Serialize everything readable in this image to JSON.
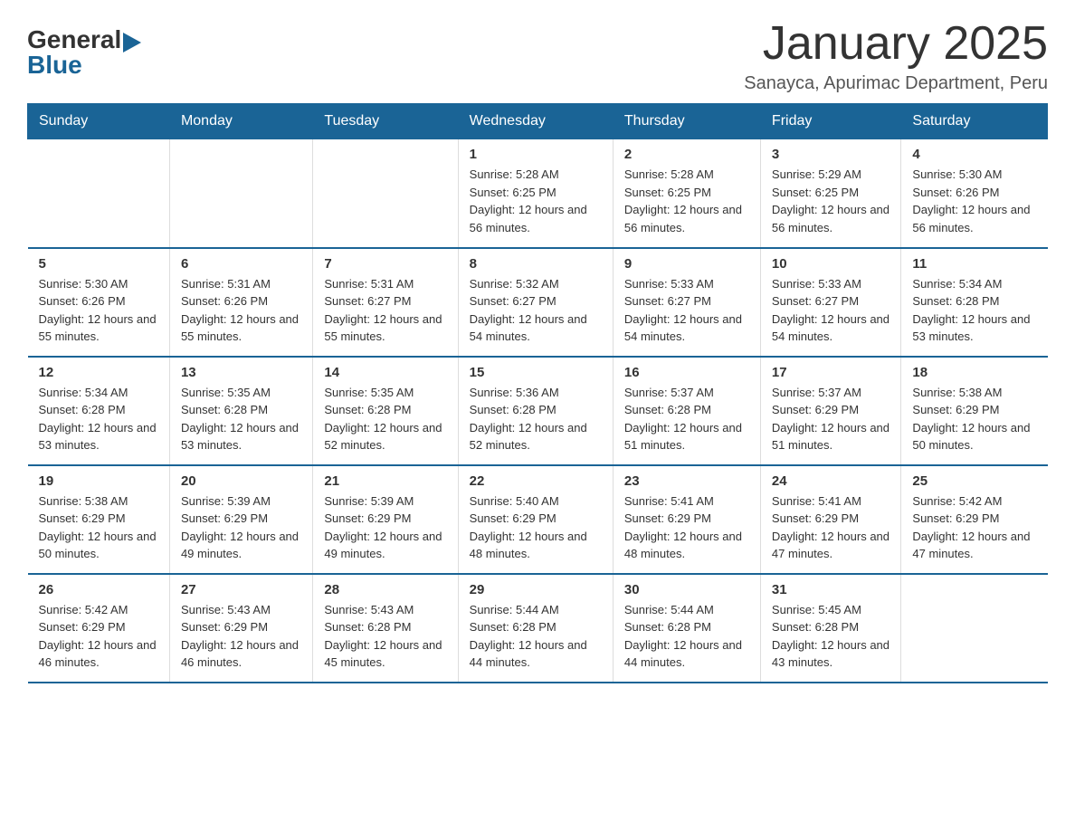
{
  "logo": {
    "general": "General",
    "arrow": "▶",
    "blue": "Blue"
  },
  "title": "January 2025",
  "subtitle": "Sanayca, Apurimac Department, Peru",
  "headers": [
    "Sunday",
    "Monday",
    "Tuesday",
    "Wednesday",
    "Thursday",
    "Friday",
    "Saturday"
  ],
  "weeks": [
    [
      {
        "day": "",
        "info": ""
      },
      {
        "day": "",
        "info": ""
      },
      {
        "day": "",
        "info": ""
      },
      {
        "day": "1",
        "info": "Sunrise: 5:28 AM\nSunset: 6:25 PM\nDaylight: 12 hours and 56 minutes."
      },
      {
        "day": "2",
        "info": "Sunrise: 5:28 AM\nSunset: 6:25 PM\nDaylight: 12 hours and 56 minutes."
      },
      {
        "day": "3",
        "info": "Sunrise: 5:29 AM\nSunset: 6:25 PM\nDaylight: 12 hours and 56 minutes."
      },
      {
        "day": "4",
        "info": "Sunrise: 5:30 AM\nSunset: 6:26 PM\nDaylight: 12 hours and 56 minutes."
      }
    ],
    [
      {
        "day": "5",
        "info": "Sunrise: 5:30 AM\nSunset: 6:26 PM\nDaylight: 12 hours and 55 minutes."
      },
      {
        "day": "6",
        "info": "Sunrise: 5:31 AM\nSunset: 6:26 PM\nDaylight: 12 hours and 55 minutes."
      },
      {
        "day": "7",
        "info": "Sunrise: 5:31 AM\nSunset: 6:27 PM\nDaylight: 12 hours and 55 minutes."
      },
      {
        "day": "8",
        "info": "Sunrise: 5:32 AM\nSunset: 6:27 PM\nDaylight: 12 hours and 54 minutes."
      },
      {
        "day": "9",
        "info": "Sunrise: 5:33 AM\nSunset: 6:27 PM\nDaylight: 12 hours and 54 minutes."
      },
      {
        "day": "10",
        "info": "Sunrise: 5:33 AM\nSunset: 6:27 PM\nDaylight: 12 hours and 54 minutes."
      },
      {
        "day": "11",
        "info": "Sunrise: 5:34 AM\nSunset: 6:28 PM\nDaylight: 12 hours and 53 minutes."
      }
    ],
    [
      {
        "day": "12",
        "info": "Sunrise: 5:34 AM\nSunset: 6:28 PM\nDaylight: 12 hours and 53 minutes."
      },
      {
        "day": "13",
        "info": "Sunrise: 5:35 AM\nSunset: 6:28 PM\nDaylight: 12 hours and 53 minutes."
      },
      {
        "day": "14",
        "info": "Sunrise: 5:35 AM\nSunset: 6:28 PM\nDaylight: 12 hours and 52 minutes."
      },
      {
        "day": "15",
        "info": "Sunrise: 5:36 AM\nSunset: 6:28 PM\nDaylight: 12 hours and 52 minutes."
      },
      {
        "day": "16",
        "info": "Sunrise: 5:37 AM\nSunset: 6:28 PM\nDaylight: 12 hours and 51 minutes."
      },
      {
        "day": "17",
        "info": "Sunrise: 5:37 AM\nSunset: 6:29 PM\nDaylight: 12 hours and 51 minutes."
      },
      {
        "day": "18",
        "info": "Sunrise: 5:38 AM\nSunset: 6:29 PM\nDaylight: 12 hours and 50 minutes."
      }
    ],
    [
      {
        "day": "19",
        "info": "Sunrise: 5:38 AM\nSunset: 6:29 PM\nDaylight: 12 hours and 50 minutes."
      },
      {
        "day": "20",
        "info": "Sunrise: 5:39 AM\nSunset: 6:29 PM\nDaylight: 12 hours and 49 minutes."
      },
      {
        "day": "21",
        "info": "Sunrise: 5:39 AM\nSunset: 6:29 PM\nDaylight: 12 hours and 49 minutes."
      },
      {
        "day": "22",
        "info": "Sunrise: 5:40 AM\nSunset: 6:29 PM\nDaylight: 12 hours and 48 minutes."
      },
      {
        "day": "23",
        "info": "Sunrise: 5:41 AM\nSunset: 6:29 PM\nDaylight: 12 hours and 48 minutes."
      },
      {
        "day": "24",
        "info": "Sunrise: 5:41 AM\nSunset: 6:29 PM\nDaylight: 12 hours and 47 minutes."
      },
      {
        "day": "25",
        "info": "Sunrise: 5:42 AM\nSunset: 6:29 PM\nDaylight: 12 hours and 47 minutes."
      }
    ],
    [
      {
        "day": "26",
        "info": "Sunrise: 5:42 AM\nSunset: 6:29 PM\nDaylight: 12 hours and 46 minutes."
      },
      {
        "day": "27",
        "info": "Sunrise: 5:43 AM\nSunset: 6:29 PM\nDaylight: 12 hours and 46 minutes."
      },
      {
        "day": "28",
        "info": "Sunrise: 5:43 AM\nSunset: 6:28 PM\nDaylight: 12 hours and 45 minutes."
      },
      {
        "day": "29",
        "info": "Sunrise: 5:44 AM\nSunset: 6:28 PM\nDaylight: 12 hours and 44 minutes."
      },
      {
        "day": "30",
        "info": "Sunrise: 5:44 AM\nSunset: 6:28 PM\nDaylight: 12 hours and 44 minutes."
      },
      {
        "day": "31",
        "info": "Sunrise: 5:45 AM\nSunset: 6:28 PM\nDaylight: 12 hours and 43 minutes."
      },
      {
        "day": "",
        "info": ""
      }
    ]
  ]
}
